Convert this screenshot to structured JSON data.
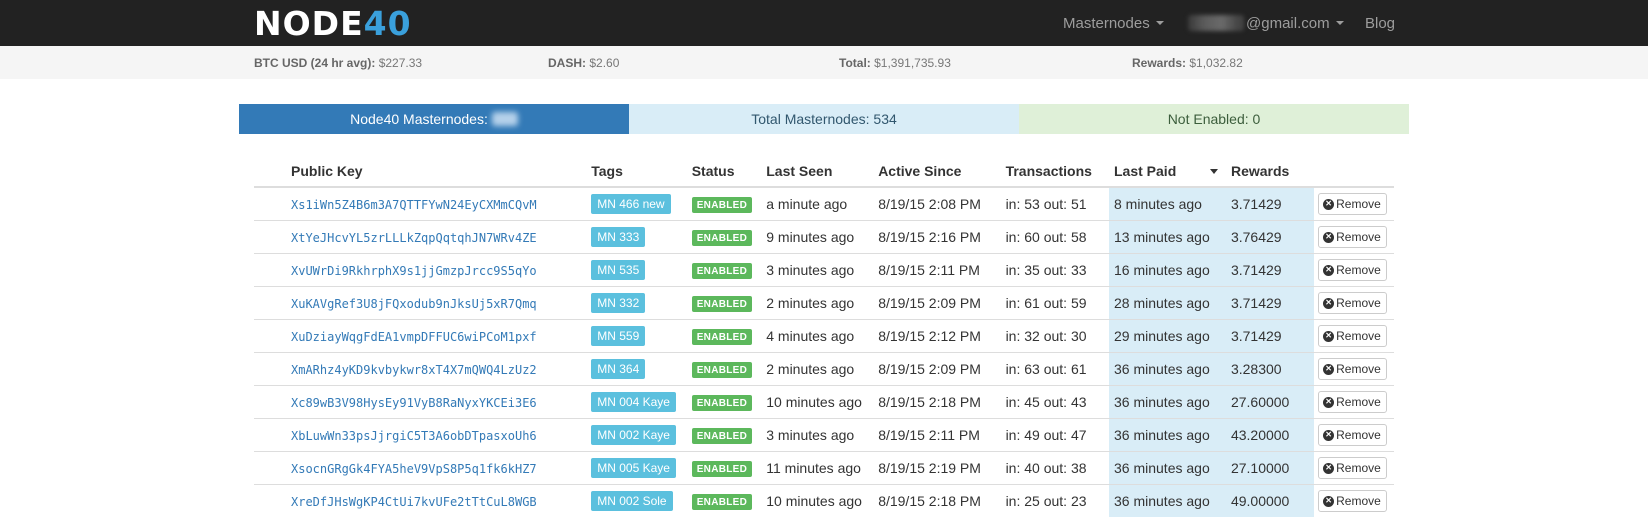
{
  "navbar": {
    "logo_node": "NODE",
    "logo_num": "40",
    "masternodes_label": "Masternodes",
    "email_suffix": "@gmail.com",
    "blog_label": "Blog"
  },
  "stats": {
    "btc_label": "BTC USD (24 hr avg):",
    "btc_value": "$227.33",
    "dash_label": "DASH:",
    "dash_value": "$2.60",
    "total_label": "Total:",
    "total_value": "$1,391,735.93",
    "rewards_label": "Rewards:",
    "rewards_value": "$1,032.82"
  },
  "summary": {
    "node40_label": "Node40 Masternodes:",
    "total_label": "Total Masternodes: 534",
    "not_enabled_label": "Not Enabled: 0"
  },
  "table": {
    "headers": {
      "public_key": "Public Key",
      "tags": "Tags",
      "status": "Status",
      "last_seen": "Last Seen",
      "active_since": "Active Since",
      "transactions": "Transactions",
      "last_paid": "Last Paid",
      "rewards": "Rewards"
    },
    "remove_label": "Remove",
    "rows": [
      {
        "key": "Xs1iWn5Z4B6m3A7QTTFYwN24EyCXMmCQvM",
        "tag": "MN 466 new",
        "status": "ENABLED",
        "last_seen": "a minute ago",
        "active_since": "8/19/15 2:08 PM",
        "transactions": "in: 53 out: 51",
        "last_paid": "8 minutes ago",
        "rewards": "3.71429"
      },
      {
        "key": "XtYeJHcvYL5zrLLLkZqpQqtqhJN7WRv4ZE",
        "tag": "MN 333",
        "status": "ENABLED",
        "last_seen": "9 minutes ago",
        "active_since": "8/19/15 2:16 PM",
        "transactions": "in: 60 out: 58",
        "last_paid": "13 minutes ago",
        "rewards": "3.76429"
      },
      {
        "key": "XvUWrDi9RkhrphX9s1jjGmzpJrcc9S5qYo",
        "tag": "MN 535",
        "status": "ENABLED",
        "last_seen": "3 minutes ago",
        "active_since": "8/19/15 2:11 PM",
        "transactions": "in: 35 out: 33",
        "last_paid": "16 minutes ago",
        "rewards": "3.71429"
      },
      {
        "key": "XuKAVgRef3U8jFQxodub9nJksUj5xR7Qmq",
        "tag": "MN 332",
        "status": "ENABLED",
        "last_seen": "2 minutes ago",
        "active_since": "8/19/15 2:09 PM",
        "transactions": "in: 61 out: 59",
        "last_paid": "28 minutes ago",
        "rewards": "3.71429"
      },
      {
        "key": "XuDziayWqgFdEA1vmpDFFUC6wiPCoM1pxf",
        "tag": "MN 559",
        "status": "ENABLED",
        "last_seen": "4 minutes ago",
        "active_since": "8/19/15 2:12 PM",
        "transactions": "in: 32 out: 30",
        "last_paid": "29 minutes ago",
        "rewards": "3.71429"
      },
      {
        "key": "XmARhz4yKD9kvbykwr8xT4X7mQWQ4LzUz2",
        "tag": "MN 364",
        "status": "ENABLED",
        "last_seen": "2 minutes ago",
        "active_since": "8/19/15 2:09 PM",
        "transactions": "in: 63 out: 61",
        "last_paid": "36 minutes ago",
        "rewards": "3.28300"
      },
      {
        "key": "Xc89wB3V98HysEy91VyB8RaNyxYKCEi3E6",
        "tag": "MN 004 Kaye",
        "status": "ENABLED",
        "last_seen": "10 minutes ago",
        "active_since": "8/19/15 2:18 PM",
        "transactions": "in: 45 out: 43",
        "last_paid": "36 minutes ago",
        "rewards": "27.60000"
      },
      {
        "key": "XbLuwWn33psJjrgiC5T3A6obDTpasxoUh6",
        "tag": "MN 002 Kaye",
        "status": "ENABLED",
        "last_seen": "3 minutes ago",
        "active_since": "8/19/15 2:11 PM",
        "transactions": "in: 49 out: 47",
        "last_paid": "36 minutes ago",
        "rewards": "43.20000"
      },
      {
        "key": "XsocnGRgGk4FYA5heV9VpS8P5q1fk6kHZ7",
        "tag": "MN 005 Kaye",
        "status": "ENABLED",
        "last_seen": "11 minutes ago",
        "active_since": "8/19/15 2:19 PM",
        "transactions": "in: 40 out: 38",
        "last_paid": "36 minutes ago",
        "rewards": "27.10000"
      },
      {
        "key": "XreDfJHsWgKP4CtUi7kvUFe2tTtCuL8WGB",
        "tag": "MN 002 Sole",
        "status": "ENABLED",
        "last_seen": "10 minutes ago",
        "active_since": "8/19/15 2:18 PM",
        "transactions": "in: 25 out: 23",
        "last_paid": "36 minutes ago",
        "rewards": "49.00000"
      }
    ]
  }
}
